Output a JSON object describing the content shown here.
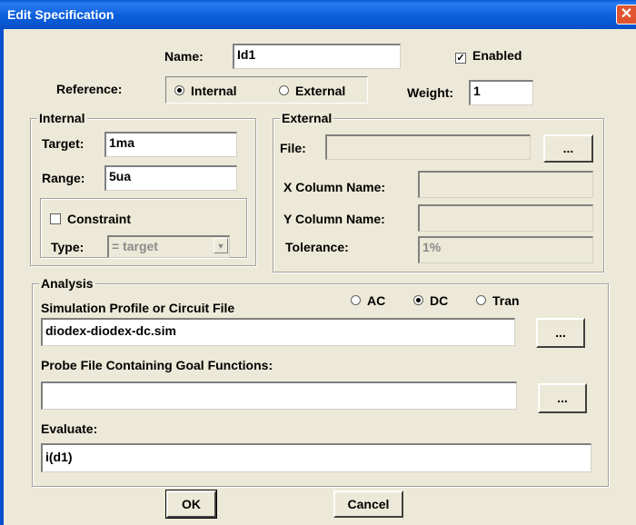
{
  "window": {
    "title": "Edit Specification",
    "close_glyph": "✕"
  },
  "name": {
    "label": "Name:",
    "value": "Id1"
  },
  "enabled": {
    "label": "Enabled",
    "checked": true,
    "check_glyph": "✓"
  },
  "reference": {
    "label": "Reference:",
    "options": [
      "Internal",
      "External"
    ],
    "selected": "Internal"
  },
  "weight": {
    "label": "Weight:",
    "value": "1"
  },
  "internal": {
    "title": "Internal",
    "target_label": "Target:",
    "target_value": "1ma",
    "range_label": "Range:",
    "range_value": "5ua",
    "constraint_label": "Constraint",
    "constraint_checked": false,
    "type_label": "Type:",
    "type_value": "= target"
  },
  "external": {
    "title": "External",
    "file_label": "File:",
    "file_value": "",
    "browse_label": "...",
    "xcol_label": "X Column Name:",
    "xcol_value": "",
    "ycol_label": "Y Column Name:",
    "ycol_value": "",
    "tolerance_label": "Tolerance:",
    "tolerance_value": "1%"
  },
  "analysis": {
    "title": "Analysis",
    "sim_label": "Simulation Profile or Circuit File",
    "modes": [
      "AC",
      "DC",
      "Tran"
    ],
    "selected_mode": "DC",
    "sim_value": "diodex-diodex-dc.sim",
    "sim_browse": "...",
    "probe_label": "Probe File Containing Goal Functions:",
    "probe_value": "",
    "probe_browse": "...",
    "evaluate_label": "Evaluate:",
    "evaluate_value": "i(d1)"
  },
  "buttons": {
    "ok": "OK",
    "cancel": "Cancel"
  },
  "colors": {
    "titlebar": "#0c5fdc",
    "dialog_bg": "#ece9d8",
    "close": "#e0552f"
  }
}
